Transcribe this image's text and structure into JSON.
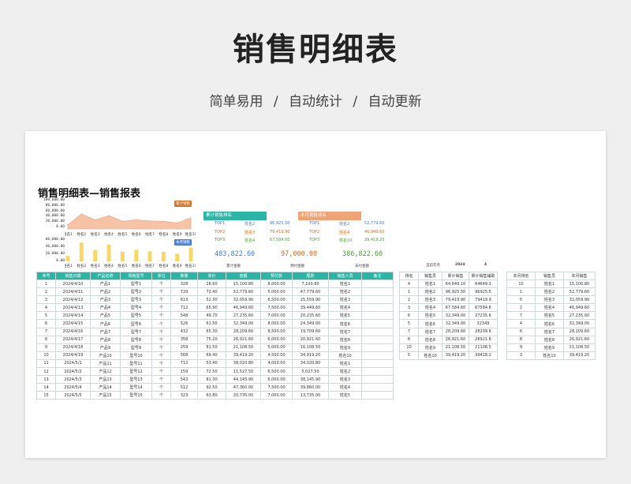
{
  "header": {
    "title": "销售明细表",
    "subtitle": "简单易用 / 自动统计 / 自动更新"
  },
  "report": {
    "title": "销售明细表—销售报表"
  },
  "charts": {
    "line_badge": "累计销售",
    "bar_badge": "本月销售",
    "line_yticks": [
      "100,000.00",
      "80,000.00",
      "60,000.00",
      "40,000.00",
      "20,000.00",
      "0.00"
    ],
    "bar_yticks": [
      "60,000.00",
      "40,000.00",
      "20,000.00",
      "0.00"
    ],
    "names": [
      "姓名1",
      "姓名2",
      "姓名3",
      "姓名4",
      "姓名5",
      "姓名6",
      "姓名7",
      "姓名8",
      "姓名9",
      "姓名10"
    ]
  },
  "chart_data": [
    {
      "type": "area",
      "title": "",
      "series": [
        {
          "name": "累计销售",
          "values": [
            15100.8,
            52779.6,
            32059.9,
            46949.6,
            27235.6,
            32349,
            28209.6,
            26921.6,
            21108.5,
            39419.2
          ]
        }
      ],
      "categories": [
        "姓名1",
        "姓名2",
        "姓名3",
        "姓名4",
        "姓名5",
        "姓名6",
        "姓名7",
        "姓名8",
        "姓名9",
        "姓名10"
      ],
      "ylim": [
        0,
        100000
      ]
    },
    {
      "type": "bar",
      "title": "",
      "series": [
        {
          "name": "本月销售",
          "values": [
            15100.8,
            52779.6,
            32059.9,
            46949.6,
            27235.6,
            32349,
            28209.6,
            26921.6,
            21108.5,
            39419.2
          ]
        }
      ],
      "categories": [
        "姓名1",
        "姓名2",
        "姓名3",
        "姓名4",
        "姓名5",
        "姓名6",
        "姓名7",
        "姓名8",
        "姓名9",
        "姓名10"
      ],
      "ylim": [
        0,
        60000
      ]
    }
  ],
  "rank_cum": {
    "title": "累计销售排名",
    "rows": [
      [
        "TOP1",
        "姓名2",
        "96,925.50"
      ],
      [
        "TOP2",
        "姓名3",
        "79,419.90"
      ],
      [
        "TOP3",
        "姓名4",
        "67,584.60"
      ]
    ]
  },
  "rank_month": {
    "title": "本月销售排名",
    "rows": [
      [
        "TOP1",
        "姓名2",
        "52,779.60"
      ],
      [
        "TOP2",
        "姓名4",
        "46,949.60"
      ],
      [
        "TOP3",
        "姓名10",
        "39,419.20"
      ]
    ]
  },
  "totals": {
    "cum": "483,822.60",
    "cum_label": "累计金额",
    "paid": "97,000.00",
    "paid_label": "预付金额",
    "unpaid": "386,822.60",
    "unpaid_label": "未付金额"
  },
  "period": {
    "label": "当前年月",
    "year": "2024",
    "month": "4"
  },
  "main_table": {
    "headers": [
      "序号",
      "销售日期",
      "产品名称",
      "规格型号",
      "单位",
      "数量",
      "单价",
      "金额",
      "预付款",
      "尾款",
      "销售人员",
      "备注"
    ],
    "rows": [
      [
        "1",
        "2024/4/10",
        "产品1",
        "型号1",
        "个",
        "328",
        "28.60",
        "15,100.80",
        "8,000.00",
        "7,100.80",
        "姓名1",
        ""
      ],
      [
        "2",
        "2024/4/11",
        "产品2",
        "型号2",
        "个",
        "729",
        "72.40",
        "52,779.60",
        "5,000.00",
        "47,779.60",
        "姓名2",
        ""
      ],
      [
        "3",
        "2024/4/12",
        "产品3",
        "型号3",
        "个",
        "613",
        "52.30",
        "32,059.90",
        "6,500.00",
        "25,559.90",
        "姓名3",
        ""
      ],
      [
        "4",
        "2024/4/13",
        "产品4",
        "型号4",
        "个",
        "712",
        "65.90",
        "46,949.60",
        "7,500.00",
        "39,449.60",
        "姓名4",
        ""
      ],
      [
        "5",
        "2024/4/14",
        "产品5",
        "型号5",
        "个",
        "548",
        "49.70",
        "27,235.60",
        "7,000.00",
        "20,235.60",
        "姓名5",
        ""
      ],
      [
        "6",
        "2024/4/15",
        "产品6",
        "型号6",
        "个",
        "526",
        "61.50",
        "32,349.00",
        "8,000.00",
        "24,349.00",
        "姓名6",
        ""
      ],
      [
        "7",
        "2024/4/16",
        "产品7",
        "型号7",
        "个",
        "432",
        "65.30",
        "28,209.60",
        "8,500.00",
        "19,709.60",
        "姓名7",
        ""
      ],
      [
        "8",
        "2024/4/17",
        "产品8",
        "型号8",
        "个",
        "358",
        "75.20",
        "26,921.60",
        "6,000.00",
        "20,921.60",
        "姓名8",
        ""
      ],
      [
        "9",
        "2024/4/18",
        "产品9",
        "型号9",
        "个",
        "259",
        "81.50",
        "21,108.50",
        "5,000.00",
        "16,108.50",
        "姓名9",
        ""
      ],
      [
        "10",
        "2024/4/19",
        "产品10",
        "型号10",
        "个",
        "568",
        "69.40",
        "39,419.20",
        "4,500.00",
        "34,919.20",
        "姓名10",
        ""
      ],
      [
        "11",
        "2024/5/1",
        "产品11",
        "型号11",
        "个",
        "712",
        "53.40",
        "38,020.80",
        "4,000.00",
        "34,020.80",
        "姓名1",
        ""
      ],
      [
        "12",
        "2024/5/2",
        "产品12",
        "型号12",
        "个",
        "159",
        "72.50",
        "11,527.50",
        "6,500.00",
        "5,027.50",
        "姓名2",
        ""
      ],
      [
        "13",
        "2024/5/3",
        "产品13",
        "型号13",
        "个",
        "543",
        "81.30",
        "44,145.90",
        "6,000.00",
        "38,145.90",
        "姓名3",
        ""
      ],
      [
        "14",
        "2024/5/4",
        "产品14",
        "型号14",
        "个",
        "512",
        "92.50",
        "47,360.00",
        "7,500.00",
        "39,860.00",
        "姓名4",
        ""
      ],
      [
        "15",
        "2024/5/5",
        "产品15",
        "型号15",
        "个",
        "323",
        "63.80",
        "20,735.00",
        "7,000.00",
        "13,735.00",
        "姓名5",
        ""
      ]
    ]
  },
  "cum_table": {
    "headers": [
      "排名",
      "销售员",
      "累计销售",
      "累计销售辅助"
    ],
    "rows": [
      [
        "4",
        "姓名1",
        "64,649.10",
        "64649.1"
      ],
      [
        "1",
        "姓名2",
        "96,925.50",
        "96925.5"
      ],
      [
        "2",
        "姓名3",
        "79,419.90",
        "79419.9"
      ],
      [
        "3",
        "姓名4",
        "67,584.60",
        "67584.6"
      ],
      [
        "6",
        "姓名5",
        "32,349.00",
        "27235.6"
      ],
      [
        "5",
        "姓名6",
        "32,349.00",
        "32349"
      ],
      [
        "7",
        "姓名7",
        "28,209.60",
        "28209.6"
      ],
      [
        "8",
        "姓名8",
        "26,921.60",
        "26921.6"
      ],
      [
        "10",
        "姓名9",
        "21,108.50",
        "21108.5"
      ],
      [
        "5",
        "姓名10",
        "39,419.20",
        "39418.2"
      ]
    ]
  },
  "month_table": {
    "headers": [
      "本月排名",
      "销售员",
      "本月销售"
    ],
    "rows": [
      [
        "10",
        "姓名1",
        "15,100.80"
      ],
      [
        "1",
        "姓名2",
        "52,779.60"
      ],
      [
        "5",
        "姓名3",
        "32,059.90"
      ],
      [
        "2",
        "姓名4",
        "46,949.60"
      ],
      [
        "7",
        "姓名5",
        "27,235.60"
      ],
      [
        "4",
        "姓名6",
        "32,349.00"
      ],
      [
        "6",
        "姓名7",
        "28,209.60"
      ],
      [
        "8",
        "姓名8",
        "26,921.60"
      ],
      [
        "9",
        "姓名9",
        "21,108.50"
      ],
      [
        "3",
        "姓名10",
        "39,419.20"
      ]
    ]
  },
  "colors": {
    "teal": "#2bb5a7",
    "orange": "#f0a374",
    "area": "#f7c3a6",
    "bar": "#f7d76a",
    "badge_orange": "#d3762c",
    "badge_blue": "#4a7fd6",
    "blue": "#3c7dd8",
    "red": "#d2691e",
    "green": "#4f9a3b"
  }
}
